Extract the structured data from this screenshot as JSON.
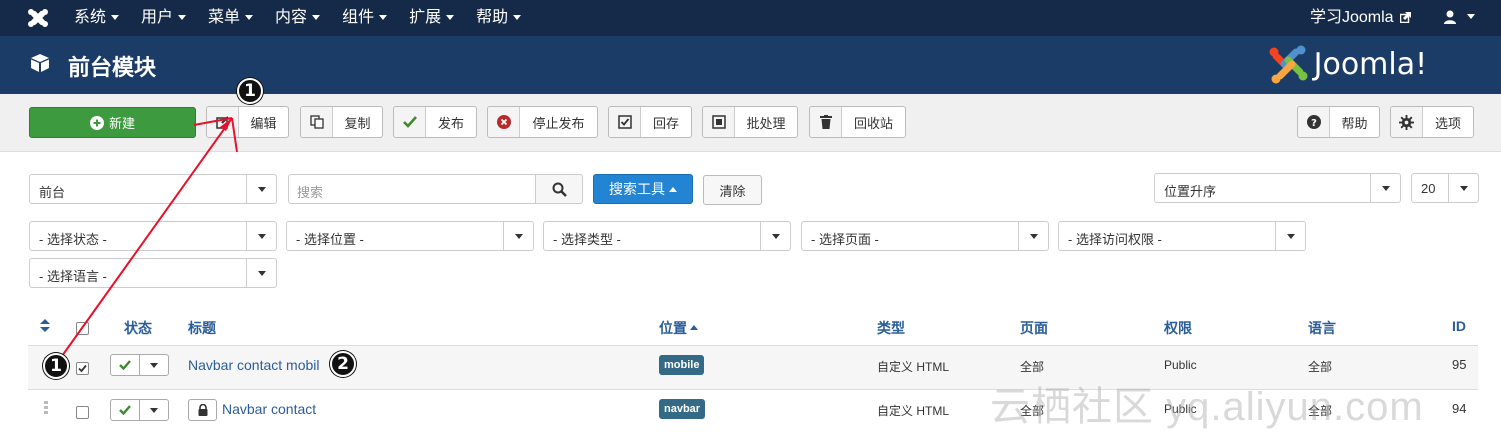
{
  "topbar": {
    "menu": [
      "系统",
      "用户",
      "菜单",
      "内容",
      "组件",
      "扩展",
      "帮助"
    ],
    "learn_link": "学习Joomla",
    "icons": {
      "logo": "joomla-logo-icon",
      "external": "external-link-icon",
      "user": "user-icon"
    }
  },
  "header": {
    "title": "前台模块",
    "brand": "Joomla!",
    "icon": "cube-icon"
  },
  "toolbar": {
    "new": "新建",
    "edit": "编辑",
    "copy": "复制",
    "publish": "发布",
    "unpublish": "停止发布",
    "archive": "回存",
    "batch": "批处理",
    "trash": "回收站",
    "help": "帮助",
    "options": "选项"
  },
  "filters": {
    "client": "前台",
    "search_placeholder": "搜索",
    "search_tools": "搜索工具",
    "clear": "清除",
    "sort": "位置升序",
    "limit": "20",
    "state": "- 选择状态 -",
    "position": "- 选择位置 -",
    "type": "- 选择类型 -",
    "page": "- 选择页面 -",
    "access": "- 选择访问权限 -",
    "language": "- 选择语言 -"
  },
  "table": {
    "headers": {
      "status": "状态",
      "title": "标题",
      "position": "位置",
      "type": "类型",
      "pages": "页面",
      "access": "权限",
      "language": "语言",
      "id": "ID"
    },
    "rows": [
      {
        "title": "Navbar contact mobil",
        "position": "mobile",
        "type": "自定义 HTML",
        "pages": "全部",
        "access": "Public",
        "language": "全部",
        "id": "95",
        "checked": true,
        "locked": false
      },
      {
        "title": "Navbar contact",
        "position": "navbar",
        "type": "自定义 HTML",
        "pages": "全部",
        "access": "Public",
        "language": "全部",
        "id": "94",
        "checked": false,
        "locked": true
      }
    ]
  },
  "annotations": {
    "m1": "1",
    "m2": "1",
    "m3": "2"
  },
  "watermark": "云栖社区 yq.aliyun.com",
  "colors": {
    "topbar": "#152a48",
    "header": "#1b3c66",
    "new_button": "#3e9a3e",
    "search_tools": "#2384d3",
    "link": "#2a5d9a",
    "badge": "#356a87",
    "annotation_arrow": "#e8102a"
  }
}
